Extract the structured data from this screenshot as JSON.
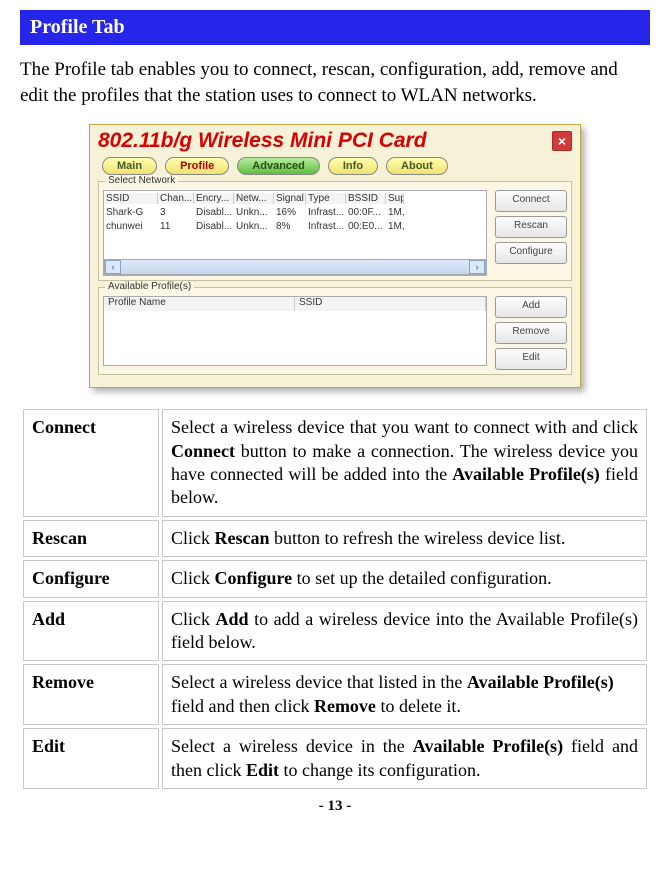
{
  "header": "Profile Tab",
  "intro": "The Profile tab enables you to connect, rescan, configuration, add, remove and edit the profiles that the station uses to connect to WLAN networks.",
  "app": {
    "title": "802.11b/g Wireless Mini PCI Card",
    "close": "×",
    "tabs": [
      "Main",
      "Profile",
      "Advanced",
      "Info",
      "About"
    ],
    "select_network_label": "Select Network",
    "net_headers": [
      "SSID",
      "Chan...",
      "Encry...",
      "Netw...",
      "Signal",
      "Type",
      "BSSID",
      "Sup"
    ],
    "net_rows": [
      [
        "Shark-G",
        "3",
        "Disabl...",
        "Unkn...",
        "16%",
        "Infrast...",
        "00:0F...",
        "1M,"
      ],
      [
        "chunwei",
        "11",
        "Disabl...",
        "Unkn...",
        "8%",
        "Infrast...",
        "00:E0...",
        "1M,"
      ]
    ],
    "scroll_left": "‹",
    "scroll_right": "›",
    "net_buttons": [
      "Connect",
      "Rescan",
      "Configure"
    ],
    "available_label": "Available Profile(s)",
    "profile_headers": [
      "Profile Name",
      "SSID"
    ],
    "profile_buttons": [
      "Add",
      "Remove",
      "Edit"
    ]
  },
  "table": {
    "rows": [
      {
        "term": "Connect",
        "desc_pre": "Select a wireless device that you want to connect with and click ",
        "b1": "Connect",
        "desc_mid": " button to make a connection. The wireless device you have connected will be added into the ",
        "b2": "Available Profile(s)",
        "desc_post": " field below."
      },
      {
        "term": "Rescan",
        "desc_pre": "Click ",
        "b1": "Rescan",
        "desc_post": " button to refresh the wireless device list."
      },
      {
        "term": "Configure",
        "desc_pre": "Click ",
        "b1": "Configure",
        "desc_post": " to set up the detailed configuration."
      },
      {
        "term": "Add",
        "desc_pre": "Click ",
        "b1": "Add",
        "desc_post": " to add a wireless device into the Available Profile(s) field below."
      },
      {
        "term": "Remove",
        "desc_pre": "Select a wireless device that listed in the ",
        "b1": "Available Profile(s)",
        "desc_mid": " field and then click ",
        "b2": "Remove",
        "desc_post": " to delete it."
      },
      {
        "term": "Edit",
        "desc_pre": "Select a wireless device in the ",
        "b1": "Available Profile(s)",
        "desc_mid": " field and then click ",
        "b2": "Edit",
        "desc_post": " to change its configuration."
      }
    ]
  },
  "page_number": "- 13 -"
}
